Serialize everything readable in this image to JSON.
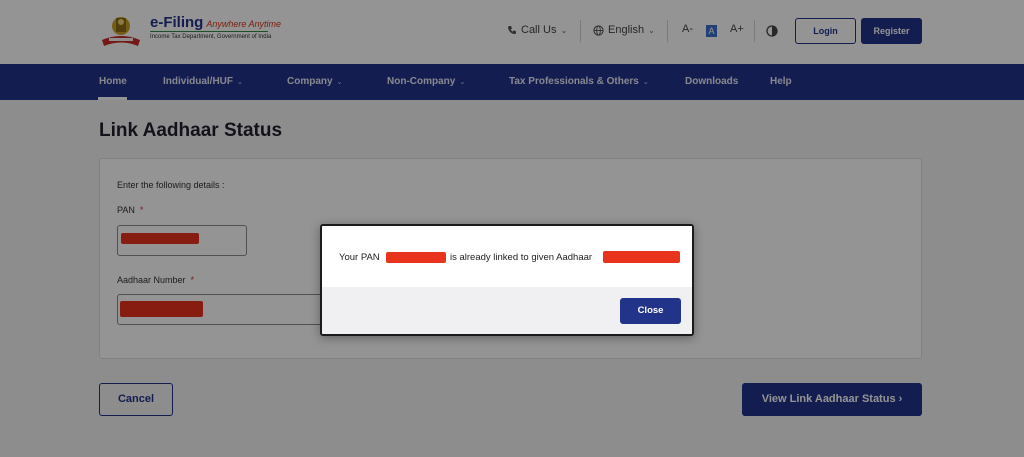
{
  "header": {
    "brand_name": "e-Filing",
    "brand_tagline": "Anywhere Anytime",
    "brand_subtitle": "Income Tax Department, Government of India",
    "call_us": "Call Us",
    "language": "English",
    "font_decrease": "A-",
    "font_default": "A",
    "font_increase": "A+",
    "login_label": "Login",
    "register_label": "Register"
  },
  "nav": {
    "items": [
      {
        "label": "Home",
        "has_dropdown": false
      },
      {
        "label": "Individual/HUF",
        "has_dropdown": true
      },
      {
        "label": "Company",
        "has_dropdown": true
      },
      {
        "label": "Non-Company",
        "has_dropdown": true
      },
      {
        "label": "Tax Professionals & Others",
        "has_dropdown": true
      },
      {
        "label": "Downloads",
        "has_dropdown": false
      },
      {
        "label": "Help",
        "has_dropdown": false
      }
    ],
    "active": "Home"
  },
  "page": {
    "title": "Link Aadhaar Status",
    "instructions": "Enter the following details :",
    "pan_label": "PAN",
    "aadhaar_label": "Aadhaar Number",
    "required_mark": "*",
    "cancel_label": "Cancel",
    "view_status_label": "View Link Aadhaar Status",
    "view_status_chevron": "›"
  },
  "modal": {
    "message_prefix": "Your PAN",
    "message_middle": "is already linked to given Aadhaar",
    "close_label": "Close"
  },
  "colors": {
    "primary": "#22338a",
    "redaction": "#e8331d",
    "required": "#d42a2a"
  },
  "icons": {
    "call": "phone-icon",
    "language": "globe-icon",
    "contrast": "contrast-icon",
    "dropdown": "chevron-down-icon"
  }
}
